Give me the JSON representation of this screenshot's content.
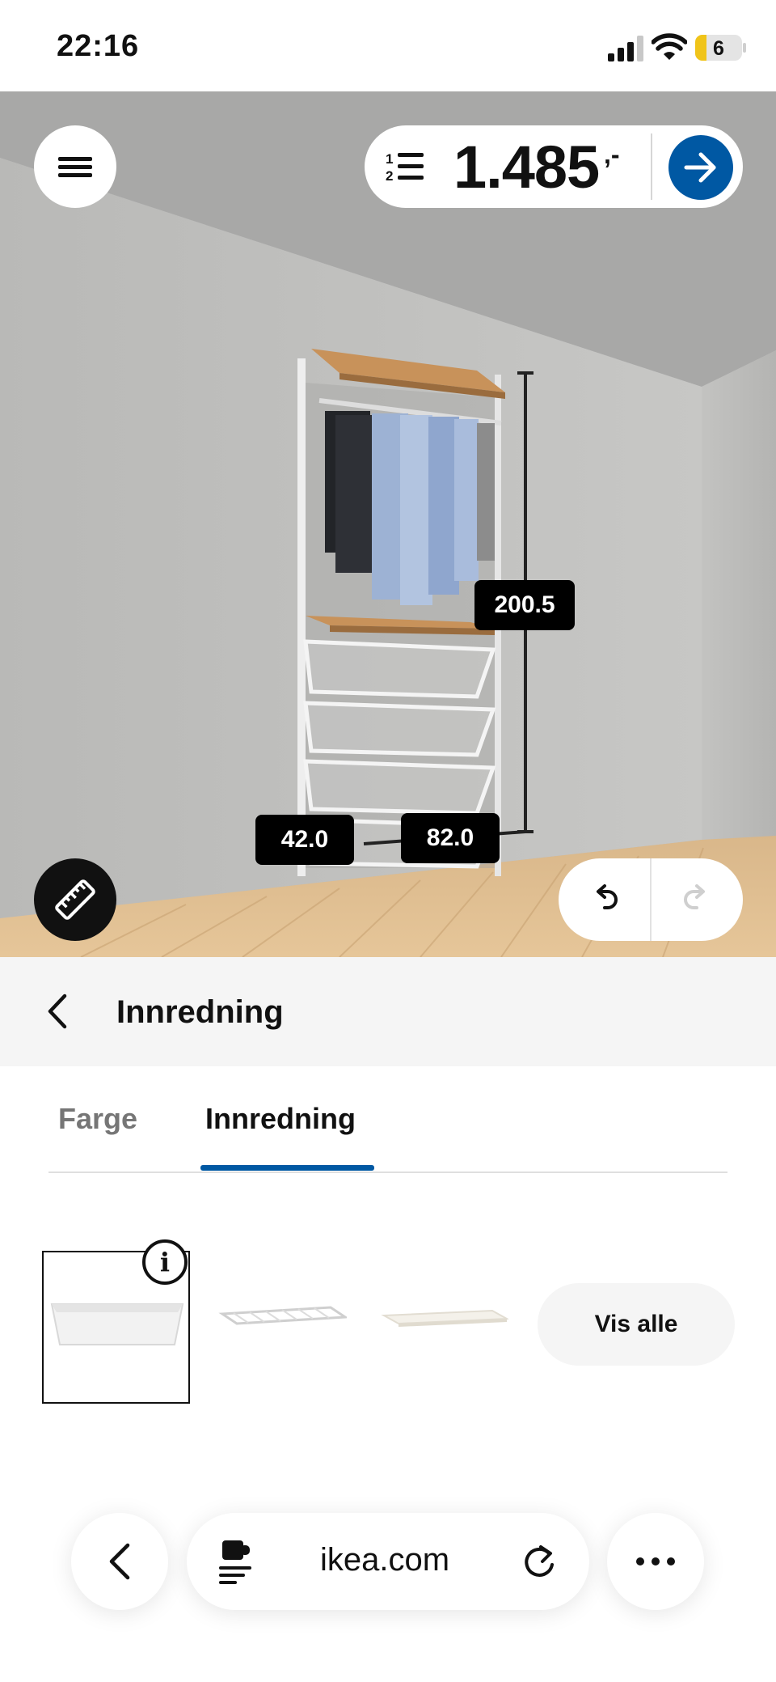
{
  "status_bar": {
    "time": "22:16",
    "battery_level": "6",
    "icons": [
      "cellular-signal-icon",
      "wifi-icon",
      "battery-icon"
    ]
  },
  "planner": {
    "menu_icon": "hamburger-menu-icon",
    "list_icon": "numbered-list-icon",
    "price": "1.485",
    "price_suffix": ",-",
    "next_icon": "arrow-right-icon",
    "accent_color": "#0058a3",
    "dimensions": {
      "height": "200.5",
      "depth": "42.0",
      "width": "82.0"
    },
    "measure_icon": "ruler-icon",
    "undo_icon": "undo-icon",
    "redo_icon": "redo-icon"
  },
  "section": {
    "back_icon": "chevron-left-icon",
    "title": "Innredning"
  },
  "tabs": [
    {
      "label": "Farge",
      "active": false
    },
    {
      "label": "Innredning",
      "active": true
    }
  ],
  "options": {
    "items": [
      {
        "icon": "wire-basket-image",
        "selected": true
      },
      {
        "icon": "wire-shelf-image",
        "selected": false
      },
      {
        "icon": "shelf-board-image",
        "selected": false
      }
    ],
    "info_icon": "info-icon",
    "show_all_label": "Vis alle"
  },
  "browser": {
    "back_icon": "chevron-left-icon",
    "reader_icon": "reader-extension-icon",
    "url": "ikea.com",
    "reload_icon": "reload-icon",
    "more_icon": "more-dots-icon"
  }
}
